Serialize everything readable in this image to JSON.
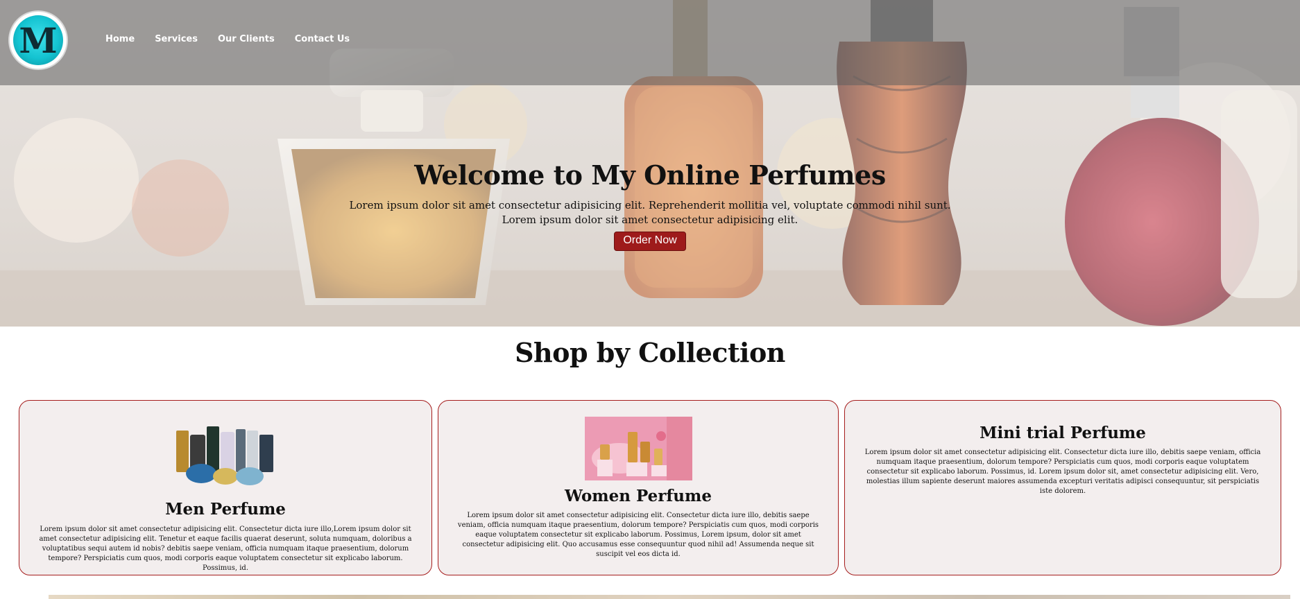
{
  "brand": {
    "logo_letter": "M"
  },
  "nav": {
    "items": [
      {
        "label": "Home"
      },
      {
        "label": "Services"
      },
      {
        "label": "Our Clients"
      },
      {
        "label": "Contact Us"
      }
    ]
  },
  "hero": {
    "title": "Welcome to My Online Perfumes",
    "text_line1": "Lorem ipsum dolor sit amet consectetur adipisicing elit. Reprehenderit mollitia vel, voluptate commodi nihil sunt.",
    "text_line2": "Lorem ipsum dolor sit amet consectetur adipisicing elit.",
    "button_label": "Order Now"
  },
  "shop": {
    "title": "Shop by Collection",
    "cards": [
      {
        "title": "Men Perfume",
        "text": "Lorem ipsum dolor sit amet consectetur adipisicing elit. Consectetur dicta iure illo,Lorem ipsum dolor sit amet consectetur adipisicing elit. Tenetur et eaque facilis quaerat deserunt, soluta numquam, doloribus a voluptatibus sequi autem id nobis? debitis saepe veniam, officia numquam itaque praesentium, dolorum tempore? Perspiciatis cum quos, modi corporis eaque voluptatem consectetur sit explicabo laborum. Possimus, id."
      },
      {
        "title": "Women Perfume",
        "text": "Lorem ipsum dolor sit amet consectetur adipisicing elit. Consectetur dicta iure illo, debitis saepe veniam, officia numquam itaque praesentium, dolorum tempore? Perspiciatis cum quos, modi corporis eaque voluptatem consectetur sit explicabo laborum. Possimus, Lorem ipsum, dolor sit amet consectetur adipisicing elit. Quo accusamus esse consequuntur quod nihil ad! Assumenda neque sit suscipit vel eos dicta id."
      },
      {
        "title": "Mini trial Perfume",
        "text": "Lorem ipsum dolor sit amet consectetur adipisicing elit. Consectetur dicta iure illo, debitis saepe veniam, officia numquam itaque praesentium, dolorum tempore? Perspiciatis cum quos, modi corporis eaque voluptatem consectetur sit explicabo laborum. Possimus, id. Lorem ipsum dolor sit, amet consectetur adipisicing elit. Vero, molestias illum sapiente deserunt maiores assumenda excepturi veritatis adipisci consequuntur, sit perspiciatis iste dolorem."
      }
    ]
  },
  "colors": {
    "accent": "#9e1b1b",
    "card_bg": "#f3eeee",
    "logo_teal": "#14c3d1"
  }
}
